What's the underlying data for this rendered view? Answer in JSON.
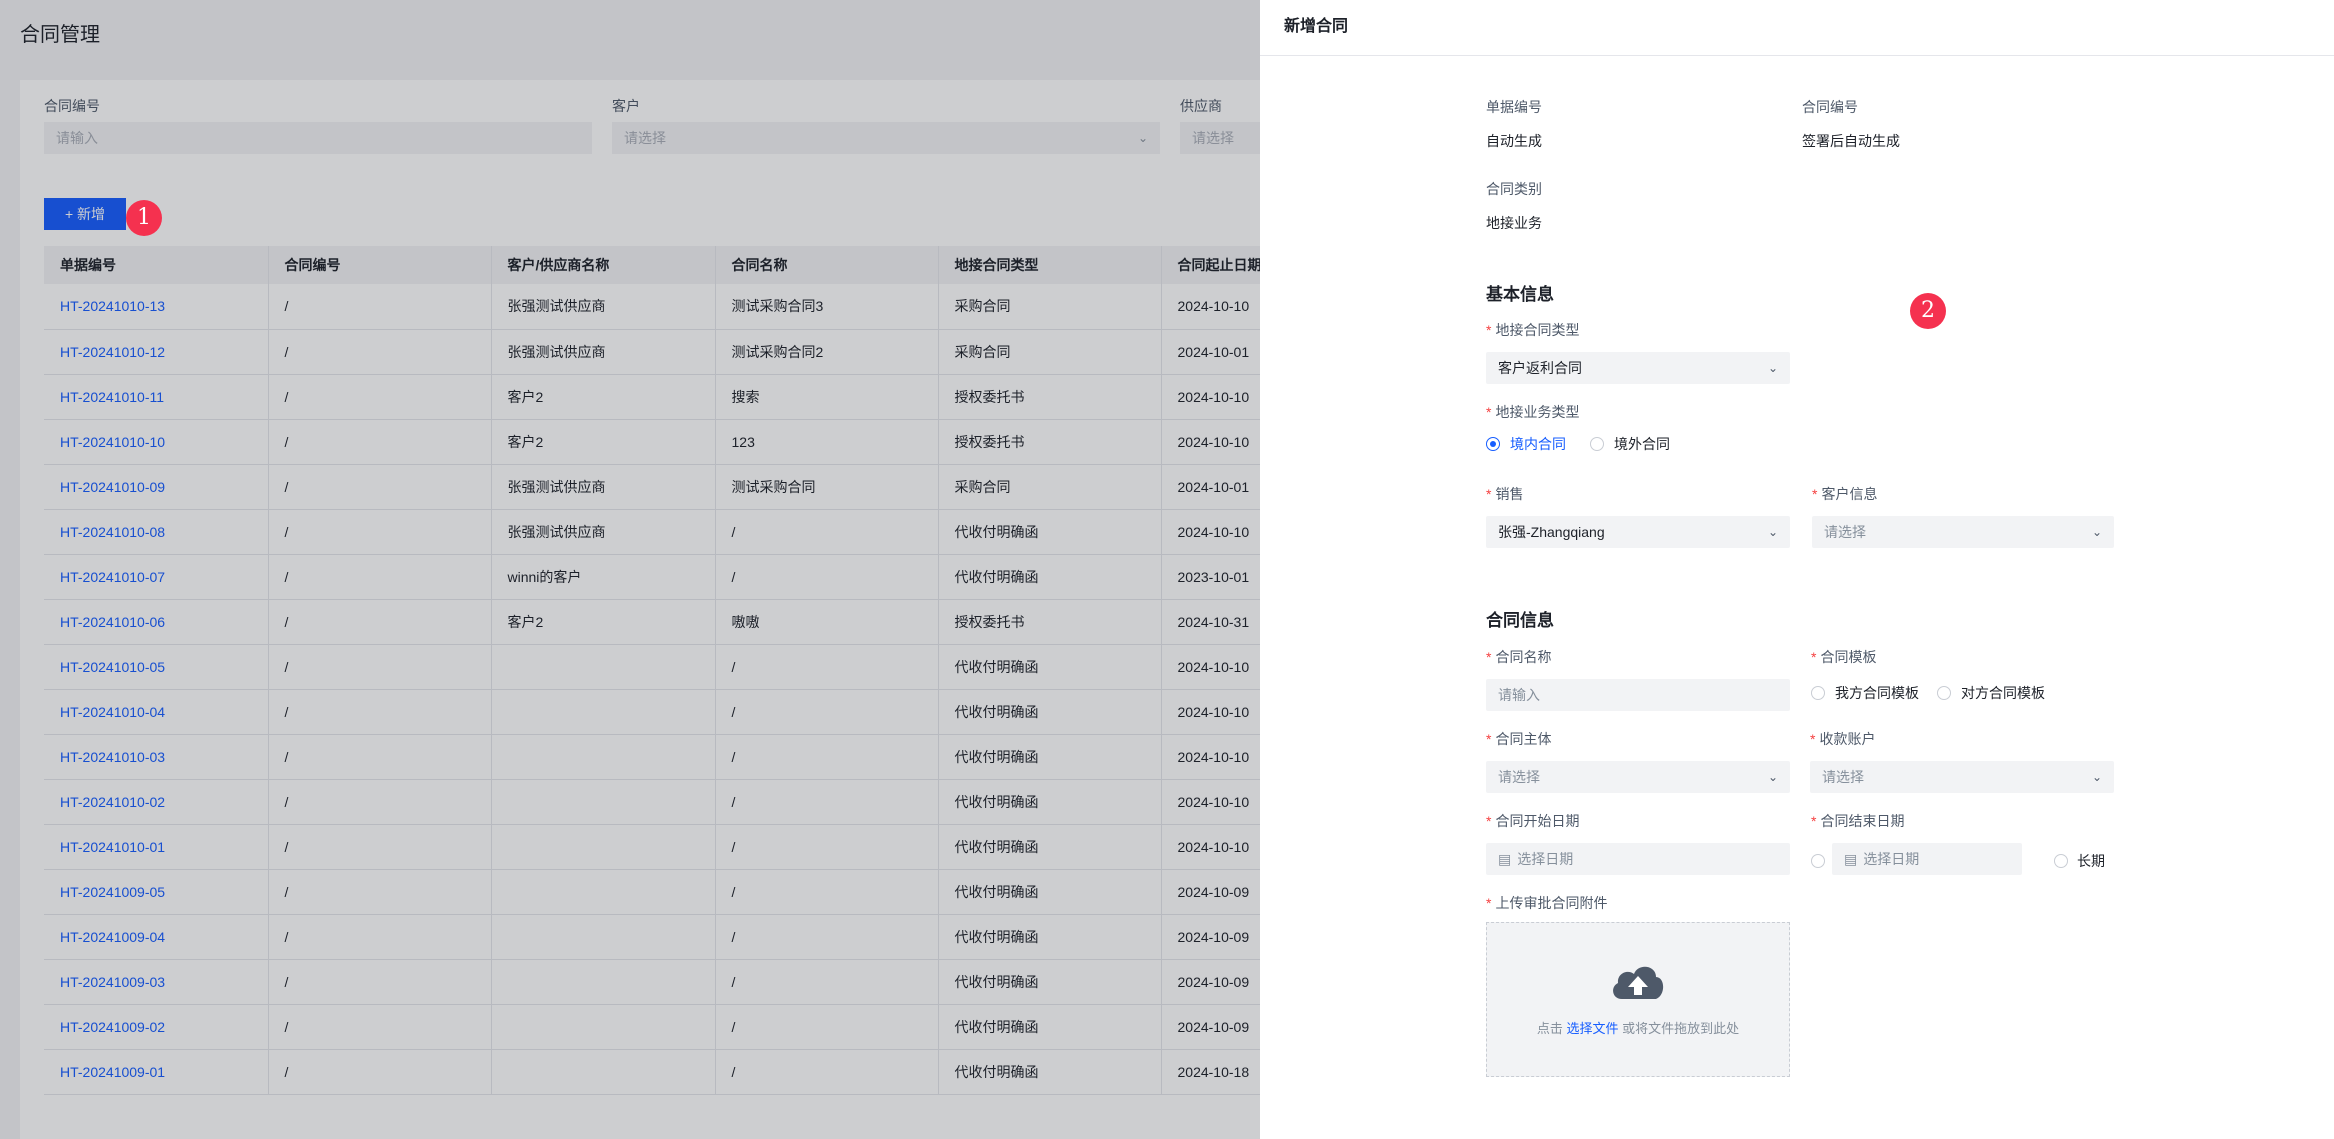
{
  "page": {
    "title": "合同管理",
    "filters": [
      {
        "label": "合同编号",
        "placeholder": "请输入",
        "dropdown": false
      },
      {
        "label": "客户",
        "placeholder": "请选择",
        "dropdown": true
      },
      {
        "label": "供应商",
        "placeholder": "请选择",
        "dropdown": true
      }
    ],
    "add_button": "新增",
    "table": {
      "headers": [
        "单据编号",
        "合同编号",
        "客户/供应商名称",
        "合同名称",
        "地接合同类型",
        "合同起止日期"
      ],
      "rows": [
        [
          "HT-20241010-13",
          "/",
          "张强测试供应商",
          "测试采购合同3",
          "采购合同",
          "2024-10-10"
        ],
        [
          "HT-20241010-12",
          "/",
          "张强测试供应商",
          "测试采购合同2",
          "采购合同",
          "2024-10-01"
        ],
        [
          "HT-20241010-11",
          "/",
          "客户2",
          "搜索",
          "授权委托书",
          "2024-10-10"
        ],
        [
          "HT-20241010-10",
          "/",
          "客户2",
          "123",
          "授权委托书",
          "2024-10-10"
        ],
        [
          "HT-20241010-09",
          "/",
          "张强测试供应商",
          "测试采购合同",
          "采购合同",
          "2024-10-01"
        ],
        [
          "HT-20241010-08",
          "/",
          "张强测试供应商",
          "/",
          "代收付明确函",
          "2024-10-10"
        ],
        [
          "HT-20241010-07",
          "/",
          "winni的客户",
          "/",
          "代收付明确函",
          "2023-10-01"
        ],
        [
          "HT-20241010-06",
          "/",
          "客户2",
          "嗷嗷",
          "授权委托书",
          "2024-10-31"
        ],
        [
          "HT-20241010-05",
          "/",
          "",
          "/",
          "代收付明确函",
          "2024-10-10"
        ],
        [
          "HT-20241010-04",
          "/",
          "",
          "/",
          "代收付明确函",
          "2024-10-10"
        ],
        [
          "HT-20241010-03",
          "/",
          "",
          "/",
          "代收付明确函",
          "2024-10-10"
        ],
        [
          "HT-20241010-02",
          "/",
          "",
          "/",
          "代收付明确函",
          "2024-10-10"
        ],
        [
          "HT-20241010-01",
          "/",
          "",
          "/",
          "代收付明确函",
          "2024-10-10"
        ],
        [
          "HT-20241009-05",
          "/",
          "",
          "/",
          "代收付明确函",
          "2024-10-09"
        ],
        [
          "HT-20241009-04",
          "/",
          "",
          "/",
          "代收付明确函",
          "2024-10-09"
        ],
        [
          "HT-20241009-03",
          "/",
          "",
          "/",
          "代收付明确函",
          "2024-10-09"
        ],
        [
          "HT-20241009-02",
          "/",
          "",
          "/",
          "代收付明确函",
          "2024-10-09"
        ],
        [
          "HT-20241009-01",
          "/",
          "",
          "/",
          "代收付明确函",
          "2024-10-18"
        ]
      ]
    }
  },
  "annotations": {
    "badge1": "1",
    "badge2": "2"
  },
  "drawer": {
    "title": "新增合同",
    "doc_no_label": "单据编号",
    "doc_no_value": "自动生成",
    "contract_no_label": "合同编号",
    "contract_no_value": "签署后自动生成",
    "category_label": "合同类别",
    "category_value": "地接业务",
    "basic_section": "基本信息",
    "contract_type_label": "地接合同类型",
    "contract_type_value": "客户返利合同",
    "biz_type_label": "地接业务类型",
    "biz_options": [
      "境内合同",
      "境外合同"
    ],
    "sales_label": "销售",
    "sales_value": "张强-Zhangqiang",
    "customer_label": "客户信息",
    "customer_placeholder": "请选择",
    "contract_section": "合同信息",
    "name_label": "合同名称",
    "name_placeholder": "请输入",
    "template_label": "合同模板",
    "template_options": [
      "我方合同模板",
      "对方合同模板"
    ],
    "entity_label": "合同主体",
    "entity_placeholder": "请选择",
    "account_label": "收款账户",
    "account_placeholder": "请选择",
    "start_label": "合同开始日期",
    "start_placeholder": "选择日期",
    "end_label": "合同结束日期",
    "end_placeholder": "选择日期",
    "long_term": "长期",
    "upload_label": "上传审批合同附件",
    "upload_tip_pre": "点击",
    "upload_tip_link": "选择文件",
    "upload_tip_post": "或将文件拖放到此处"
  }
}
